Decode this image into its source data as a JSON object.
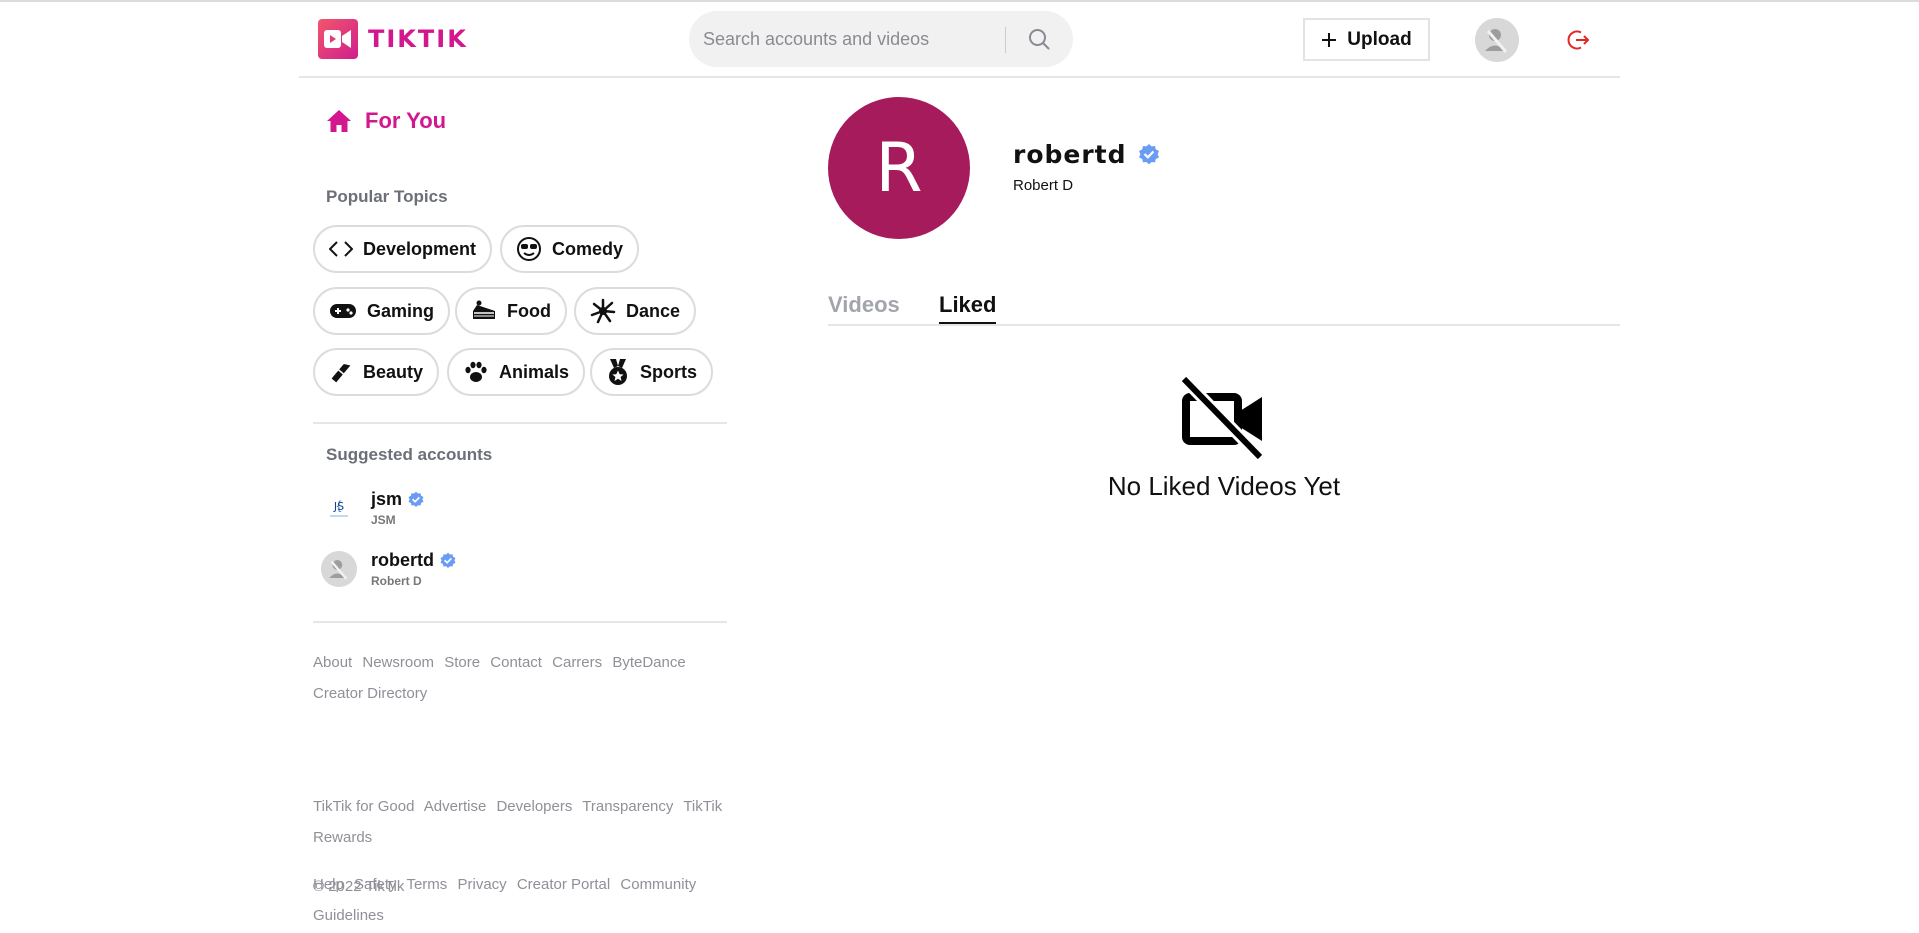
{
  "app": {
    "name": "TIKTIK"
  },
  "search": {
    "placeholder": "Search accounts and videos"
  },
  "header": {
    "upload_label": "Upload"
  },
  "sidebar": {
    "for_you_label": "For You",
    "popular_topics_title": "Popular Topics",
    "topics": [
      {
        "label": "Development",
        "icon": "code-icon"
      },
      {
        "label": "Comedy",
        "icon": "cool-face-icon"
      },
      {
        "label": "Gaming",
        "icon": "gamepad-icon"
      },
      {
        "label": "Food",
        "icon": "cake-icon"
      },
      {
        "label": "Dance",
        "icon": "spark-icon"
      },
      {
        "label": "Beauty",
        "icon": "lipstick-icon"
      },
      {
        "label": "Animals",
        "icon": "paw-icon"
      },
      {
        "label": "Sports",
        "icon": "medal-icon"
      }
    ],
    "suggested_title": "Suggested accounts",
    "accounts": [
      {
        "name": "jsm",
        "sub": "JSM",
        "logo": "JS"
      },
      {
        "name": "robertd",
        "sub": "Robert D"
      }
    ],
    "footer": {
      "group1": [
        "About",
        "Newsroom",
        "Store",
        "Contact",
        "Carrers",
        "ByteDance",
        "Creator Directory"
      ],
      "group2": [
        "TikTik for Good",
        "Advertise",
        "Developers",
        "Transparency",
        "TikTik Rewards"
      ],
      "group3": [
        "Help",
        "Safety",
        "Terms",
        "Privacy",
        "Creator Portal",
        "Community Guidelines"
      ],
      "copyright": "© 2022 TikTik"
    }
  },
  "profile": {
    "initial": "R",
    "username": "robertd",
    "display_name": "Robert D",
    "tabs": [
      "Videos",
      "Liked"
    ],
    "active_tab": "Liked",
    "empty_message": "No Liked Videos Yet"
  },
  "colors": {
    "brand": "#d3178f",
    "avatar_bg": "#a51b5c",
    "verified": "#6b9cf5",
    "logout": "#e0282a"
  }
}
